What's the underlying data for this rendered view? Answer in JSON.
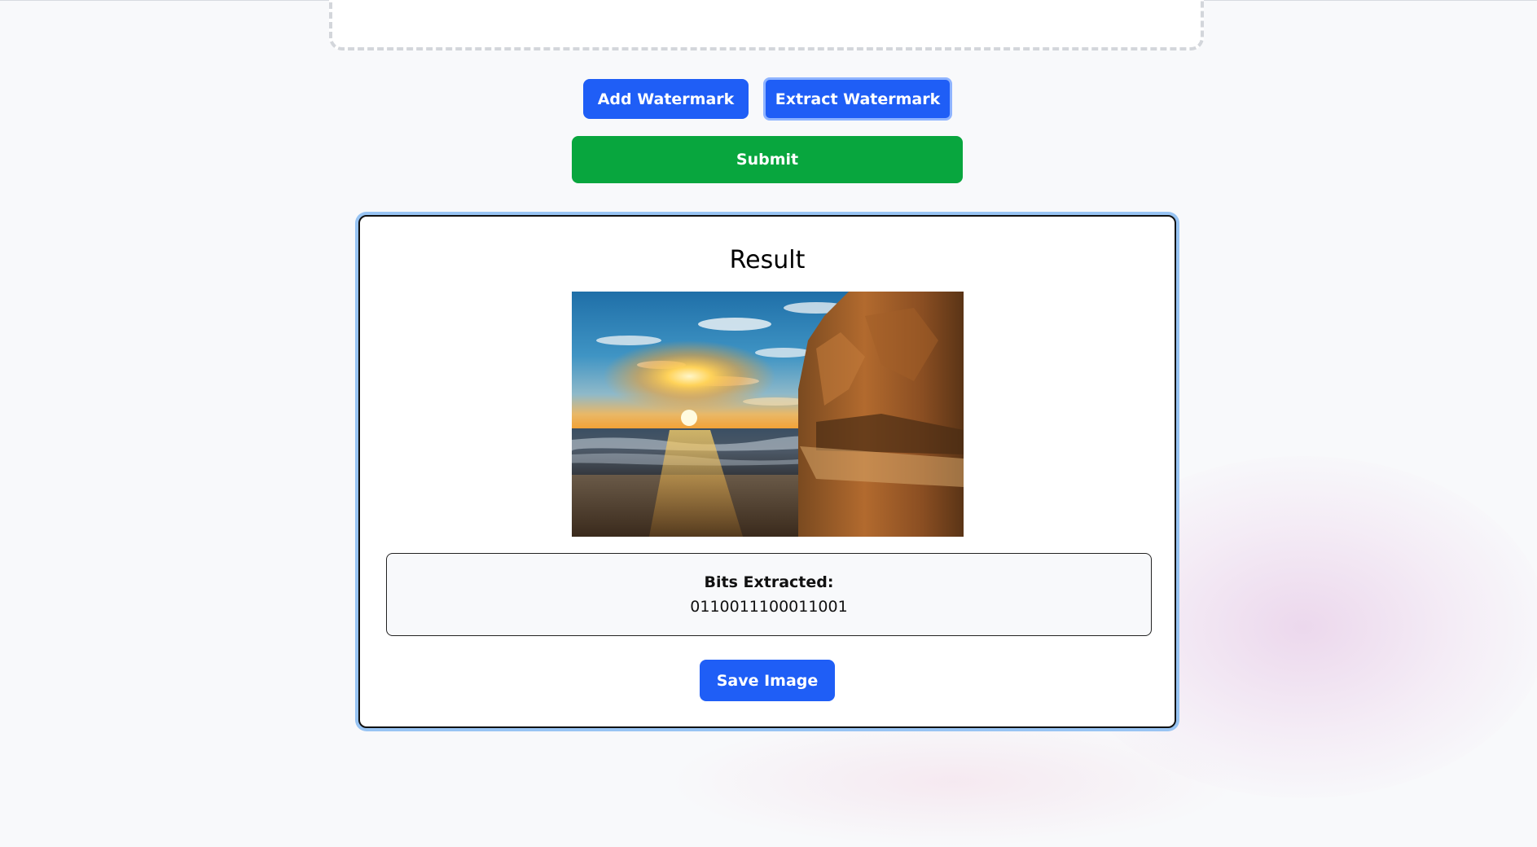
{
  "toolbar": {
    "add_watermark_label": "Add Watermark",
    "extract_watermark_label": "Extract Watermark",
    "submit_label": "Submit"
  },
  "result": {
    "title": "Result",
    "image_alt": "Sunset over ocean beach with rocky cliff",
    "bits_label": "Bits Extracted:",
    "bits_value": "0110011100011001",
    "save_label": "Save Image"
  },
  "colors": {
    "primary_blue": "#1f5ef6",
    "submit_green": "#08a63e",
    "focus_ring": "#98c4f3",
    "page_background": "#f8f9fb"
  }
}
